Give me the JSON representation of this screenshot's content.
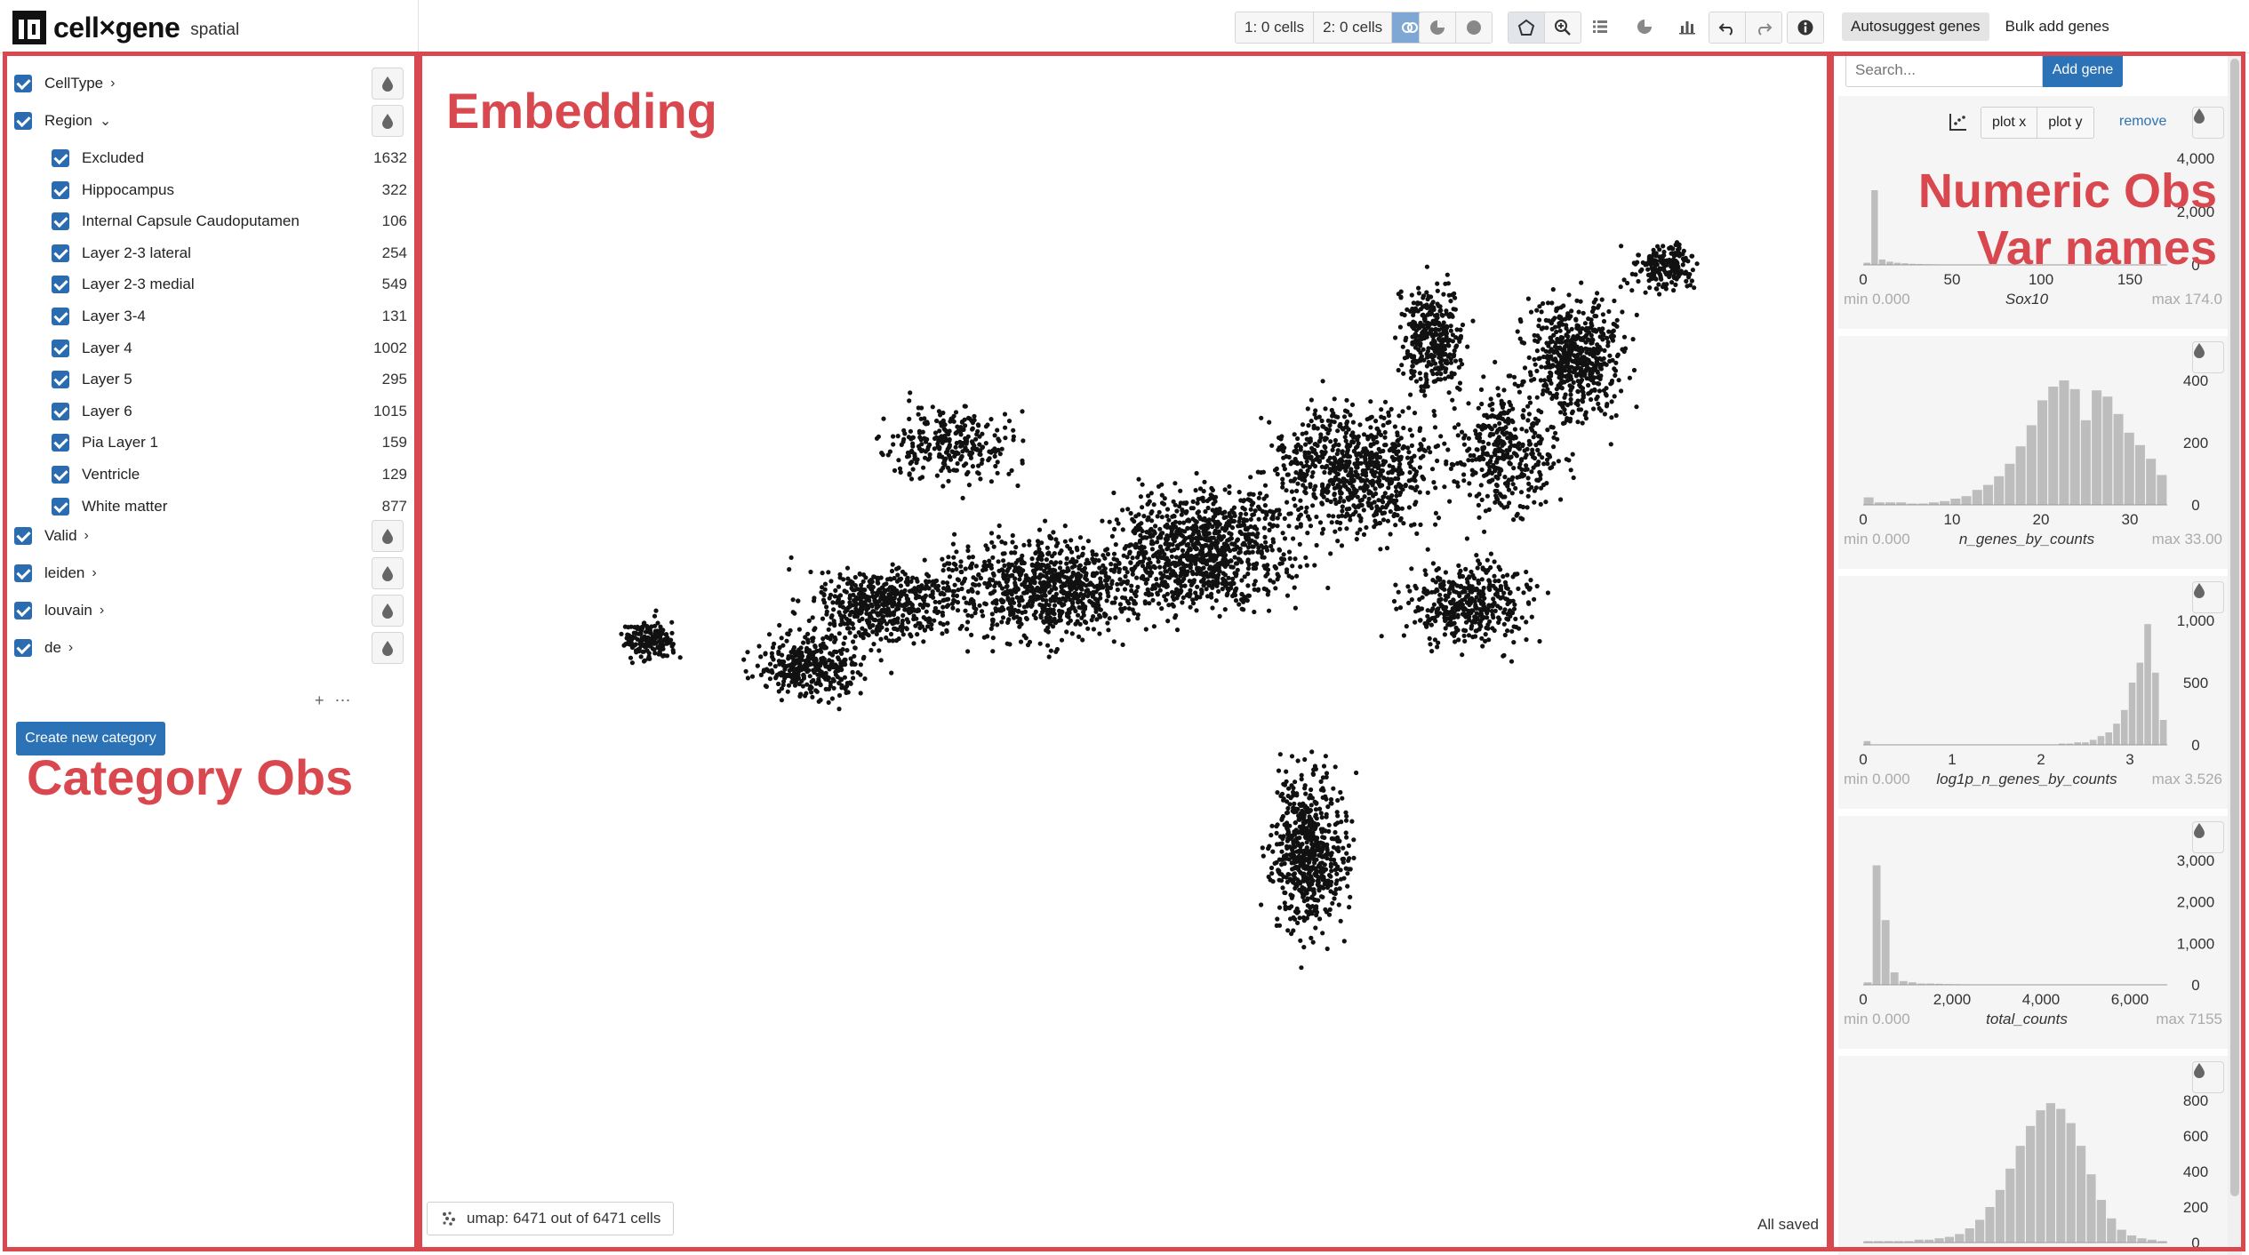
{
  "app": {
    "name": "cell×gene",
    "subtitle": "spatial"
  },
  "toolbar": {
    "cells1": "1: 0 cells",
    "cells2": "2: 0 cells",
    "icons": [
      "venn-icon",
      "half-circle-icon",
      "circle-icon",
      "lasso-icon",
      "zoom-icon",
      "list-icon",
      "pie-icon",
      "bar-chart-icon",
      "undo-icon",
      "redo-icon",
      "info-icon"
    ]
  },
  "right_tabs": {
    "autosuggest": "Autosuggest genes",
    "bulk": "Bulk add genes"
  },
  "categories": [
    {
      "label": "CellType",
      "expanded": false
    },
    {
      "label": "Region",
      "expanded": true
    }
  ],
  "region_items": [
    {
      "label": "Excluded",
      "count": "1632"
    },
    {
      "label": "Hippocampus",
      "count": "322"
    },
    {
      "label": "Internal Capsule Caudoputamen",
      "count": "106"
    },
    {
      "label": "Layer 2-3 lateral",
      "count": "254"
    },
    {
      "label": "Layer 2-3 medial",
      "count": "549"
    },
    {
      "label": "Layer 3-4",
      "count": "131"
    },
    {
      "label": "Layer 4",
      "count": "1002"
    },
    {
      "label": "Layer 5",
      "count": "295"
    },
    {
      "label": "Layer 6",
      "count": "1015"
    },
    {
      "label": "Pia Layer 1",
      "count": "159"
    },
    {
      "label": "Ventricle",
      "count": "129"
    },
    {
      "label": "White matter",
      "count": "877"
    }
  ],
  "more_categories": [
    {
      "label": "Valid"
    },
    {
      "label": "leiden"
    },
    {
      "label": "louvain"
    },
    {
      "label": "de"
    }
  ],
  "create_category": "Create new category",
  "embedding": {
    "status": "umap: 6471 out of 6471 cells",
    "saved": "All saved"
  },
  "gene_search": {
    "placeholder": "Search...",
    "add_label": "Add gene"
  },
  "histograms": [
    {
      "name": "Sox10",
      "min": "min 0.000",
      "max": "max 174.0",
      "plot_x": "plot x",
      "plot_y": "plot y",
      "remove": "remove",
      "xticks": [
        "0",
        "50",
        "100",
        "150"
      ],
      "yticks": [
        "4,000",
        "2,000",
        "0"
      ],
      "bins": [
        0.02,
        0.7,
        0.05,
        0.03,
        0.02,
        0.015,
        0.01,
        0.008,
        0.006,
        0.005,
        0.004,
        0.004,
        0.003,
        0.003,
        0.002,
        0.002,
        0.002,
        0.0015,
        0.001,
        0.001,
        0.001,
        0.001,
        0.001,
        0.0008,
        0.0008,
        0.0006,
        0.0005,
        0.0005,
        0.0004,
        0.0004,
        0.0003,
        0.0003,
        0.0002,
        0.0002,
        0.0002,
        0.0002,
        0.0001,
        0.0001,
        0.0001,
        0.0001
      ]
    },
    {
      "name": "n_genes_by_counts",
      "min": "min 0.000",
      "max": "max 33.00",
      "xticks": [
        "0",
        "10",
        "20",
        "30"
      ],
      "yticks": [
        "400",
        "200",
        "0"
      ],
      "bins": [
        0.06,
        0.02,
        0.02,
        0.02,
        0.01,
        0.01,
        0.02,
        0.03,
        0.05,
        0.07,
        0.12,
        0.16,
        0.23,
        0.33,
        0.47,
        0.64,
        0.84,
        0.95,
        1.0,
        0.93,
        0.68,
        0.92,
        0.87,
        0.73,
        0.58,
        0.48,
        0.37,
        0.24
      ]
    },
    {
      "name": "log1p_n_genes_by_counts",
      "min": "min 0.000",
      "max": "max 3.526",
      "xticks": [
        "0",
        "1",
        "2",
        "3"
      ],
      "yticks": [
        "1,000",
        "500",
        "0"
      ],
      "bins": [
        0.03,
        0.0,
        0.0,
        0.0,
        0.0,
        0.0,
        0.0,
        0.0,
        0.0,
        0.0,
        0.0,
        0.0,
        0.0,
        0.0,
        0.0,
        0.0,
        0.0,
        0.0,
        0.0,
        0.0,
        0.0,
        0.0,
        0.0,
        0.0,
        0.0,
        0.01,
        0.01,
        0.02,
        0.02,
        0.04,
        0.07,
        0.1,
        0.17,
        0.28,
        0.5,
        0.66,
        0.97,
        0.58,
        0.2
      ]
    },
    {
      "name": "total_counts",
      "min": "min 0.000",
      "max": "max 7155",
      "xticks": [
        "0",
        "2,000",
        "4,000",
        "6,000"
      ],
      "yticks": [
        "3,000",
        "2,000",
        "1,000",
        "0"
      ],
      "bins": [
        0.02,
        0.96,
        0.52,
        0.1,
        0.03,
        0.02,
        0.01,
        0.01,
        0.008,
        0.006,
        0.005,
        0.004,
        0.003,
        0.003,
        0.002,
        0.002,
        0.002,
        0.001,
        0.001,
        0.001,
        0.001,
        0.001,
        0.001,
        0.001,
        0.0008,
        0.0006,
        0.0005,
        0.0005,
        0.0004,
        0.0003,
        0.0003,
        0.0002,
        0.0002,
        0.0001
      ]
    },
    {
      "name": "",
      "min": "",
      "max": "",
      "xticks": [],
      "yticks": [
        "800",
        "600",
        "400",
        "200",
        "0"
      ],
      "bins": [
        0.01,
        0.01,
        0.01,
        0.01,
        0.01,
        0.02,
        0.02,
        0.03,
        0.04,
        0.06,
        0.1,
        0.16,
        0.25,
        0.37,
        0.52,
        0.68,
        0.82,
        0.93,
        0.98,
        0.94,
        0.84,
        0.68,
        0.48,
        0.3,
        0.17,
        0.09,
        0.05,
        0.03,
        0.02,
        0.01
      ]
    }
  ],
  "annotations": {
    "embedding": "Embedding",
    "category": "Category Obs",
    "numeric_line1": "Numeric Obs",
    "numeric_line2": "Var names",
    "color": "#d9474f"
  },
  "colors": {
    "accent": "#2b73b6",
    "active_tool": "#7ea7d4",
    "hist_bar": "#bdbdbd"
  }
}
